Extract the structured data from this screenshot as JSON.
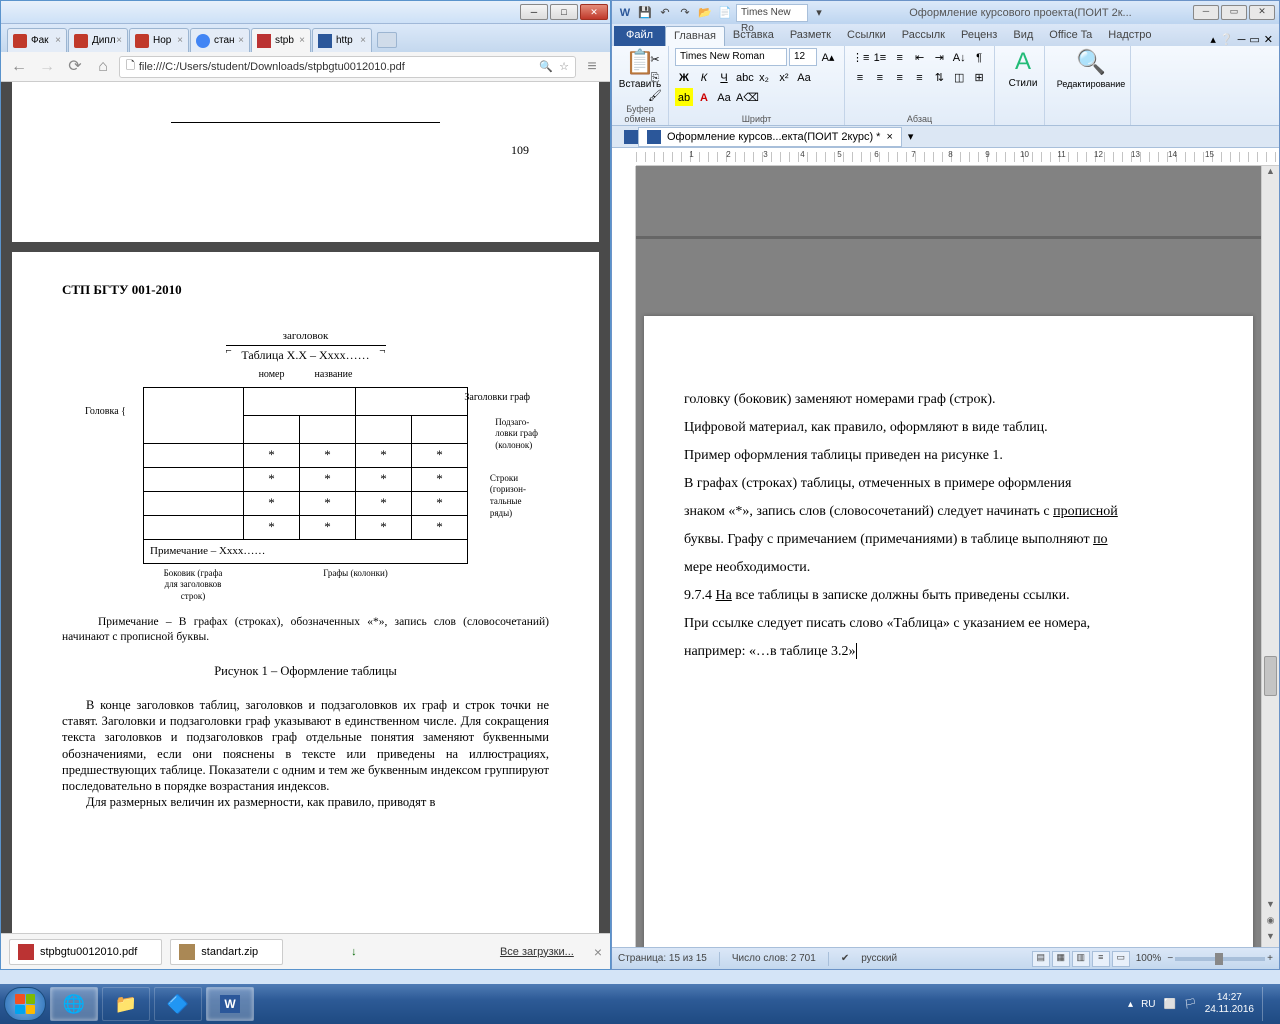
{
  "chrome": {
    "tabs": [
      {
        "title": "Фак",
        "fav": "red"
      },
      {
        "title": "Дипл",
        "fav": "red"
      },
      {
        "title": "Нор",
        "fav": "red"
      },
      {
        "title": "стан",
        "fav": "g"
      },
      {
        "title": "stpb",
        "fav": "pdf"
      },
      {
        "title": "http",
        "fav": "doc"
      }
    ],
    "address": "file:///C:/Users/student/Downloads/stpbgtu0012010.pdf",
    "pdf": {
      "top_page_num": "109",
      "doc_heading": "СТП БГТУ 001-2010",
      "diag_zagolovok": "заголовок",
      "diag_table_title": "Таблица Х.Х – Хххх……",
      "diag_nomer": "номер",
      "diag_nazvanie": "название",
      "diag_golovka": "Головка",
      "diag_zag_graf": "Заголовки граф",
      "diag_podzag": "Подзаго-\nловки граф\n(колонок)",
      "diag_stroki": "Строки\n(горизон-\nтальные\nряды)",
      "diag_prim": "Примечание – Хххх……",
      "diag_bokovik": "Боковик (графа\nдля заголовков\nстрок)",
      "diag_grafy": "Графы (колонки)",
      "para_prim": "Примечание – В графах (строках), обозначенных «*», запись слов (словосоче­таний) начинают с прописной буквы.",
      "fig_caption": "Рисунок 1 – Оформление таблицы",
      "para1": "В конце заголовков таблиц, заголовков и подзаголовков их граф и строк точки не ставят. Заголовки и подзаголовки граф указывают в единственном числе. Для сокращения текста заголовков и подзаго­ловков граф отдельные понятия заменяют буквенными обозначения­ми, если они пояснены в тексте или приведены на иллюстрациях, предшествующих таблице. Показатели с одним и тем же буквенным индексом группируют последовательно в порядке возрастания индексов.",
      "para2": "Для размерных величин их размерности, как правило, приводят в"
    },
    "downloads": {
      "item1": "stpbgtu0012010.pdf",
      "item2": "standart.zip",
      "all": "Все загрузки...",
      "arrow": "↓"
    }
  },
  "word": {
    "title": "Оформление курсового проекта(ПОИТ 2к...",
    "qat_font": "Times New Ro",
    "ribbon_tabs": [
      "Главная",
      "Вставка",
      "Разметк",
      "Ссылки",
      "Рассылк",
      "Реценз",
      "Вид",
      "Office Ta",
      "Надстро"
    ],
    "file_tab": "Файл",
    "groups": {
      "clipboard": "Буфер обмена",
      "paste": "Вставить",
      "font": "Шрифт",
      "font_name": "Times New Roman",
      "font_size": "12",
      "para": "Абзац",
      "styles": "Стили",
      "editing": "Редактирование"
    },
    "doc_tab": "Оформление курсов...екта(ПОИТ 2курс) *",
    "doc_lines": [
      "головку (боковик) заменяют номерами граф (строк).",
      "Цифровой материал, как правило, оформляют в виде таблиц.",
      "Пример оформления таблицы приведен на рисунке 1.",
      "В графах (строках) таблицы, отмеченных в примере оформления",
      "знаком «*», запись слов (словосочетаний) следует начинать с ",
      "прописной",
      " буквы. Графу с примечанием (примечаниями) в таблице выполняют ",
      "по",
      " мере необходимости.",
      "9.7.4 ",
      "Ha",
      " все таблицы в записке должны быть приведены ссылки.",
      "При ссылке следует писать слово «Таблица» с указанием ее номера,",
      "например: «…в таблице 3.2»"
    ],
    "status": {
      "page": "Страница: 15 из 15",
      "words": "Число слов: 2 701",
      "lang": "русский",
      "zoom": "100%"
    }
  },
  "taskbar": {
    "lang": "RU",
    "time": "14:27",
    "date": "24.11.2016"
  }
}
